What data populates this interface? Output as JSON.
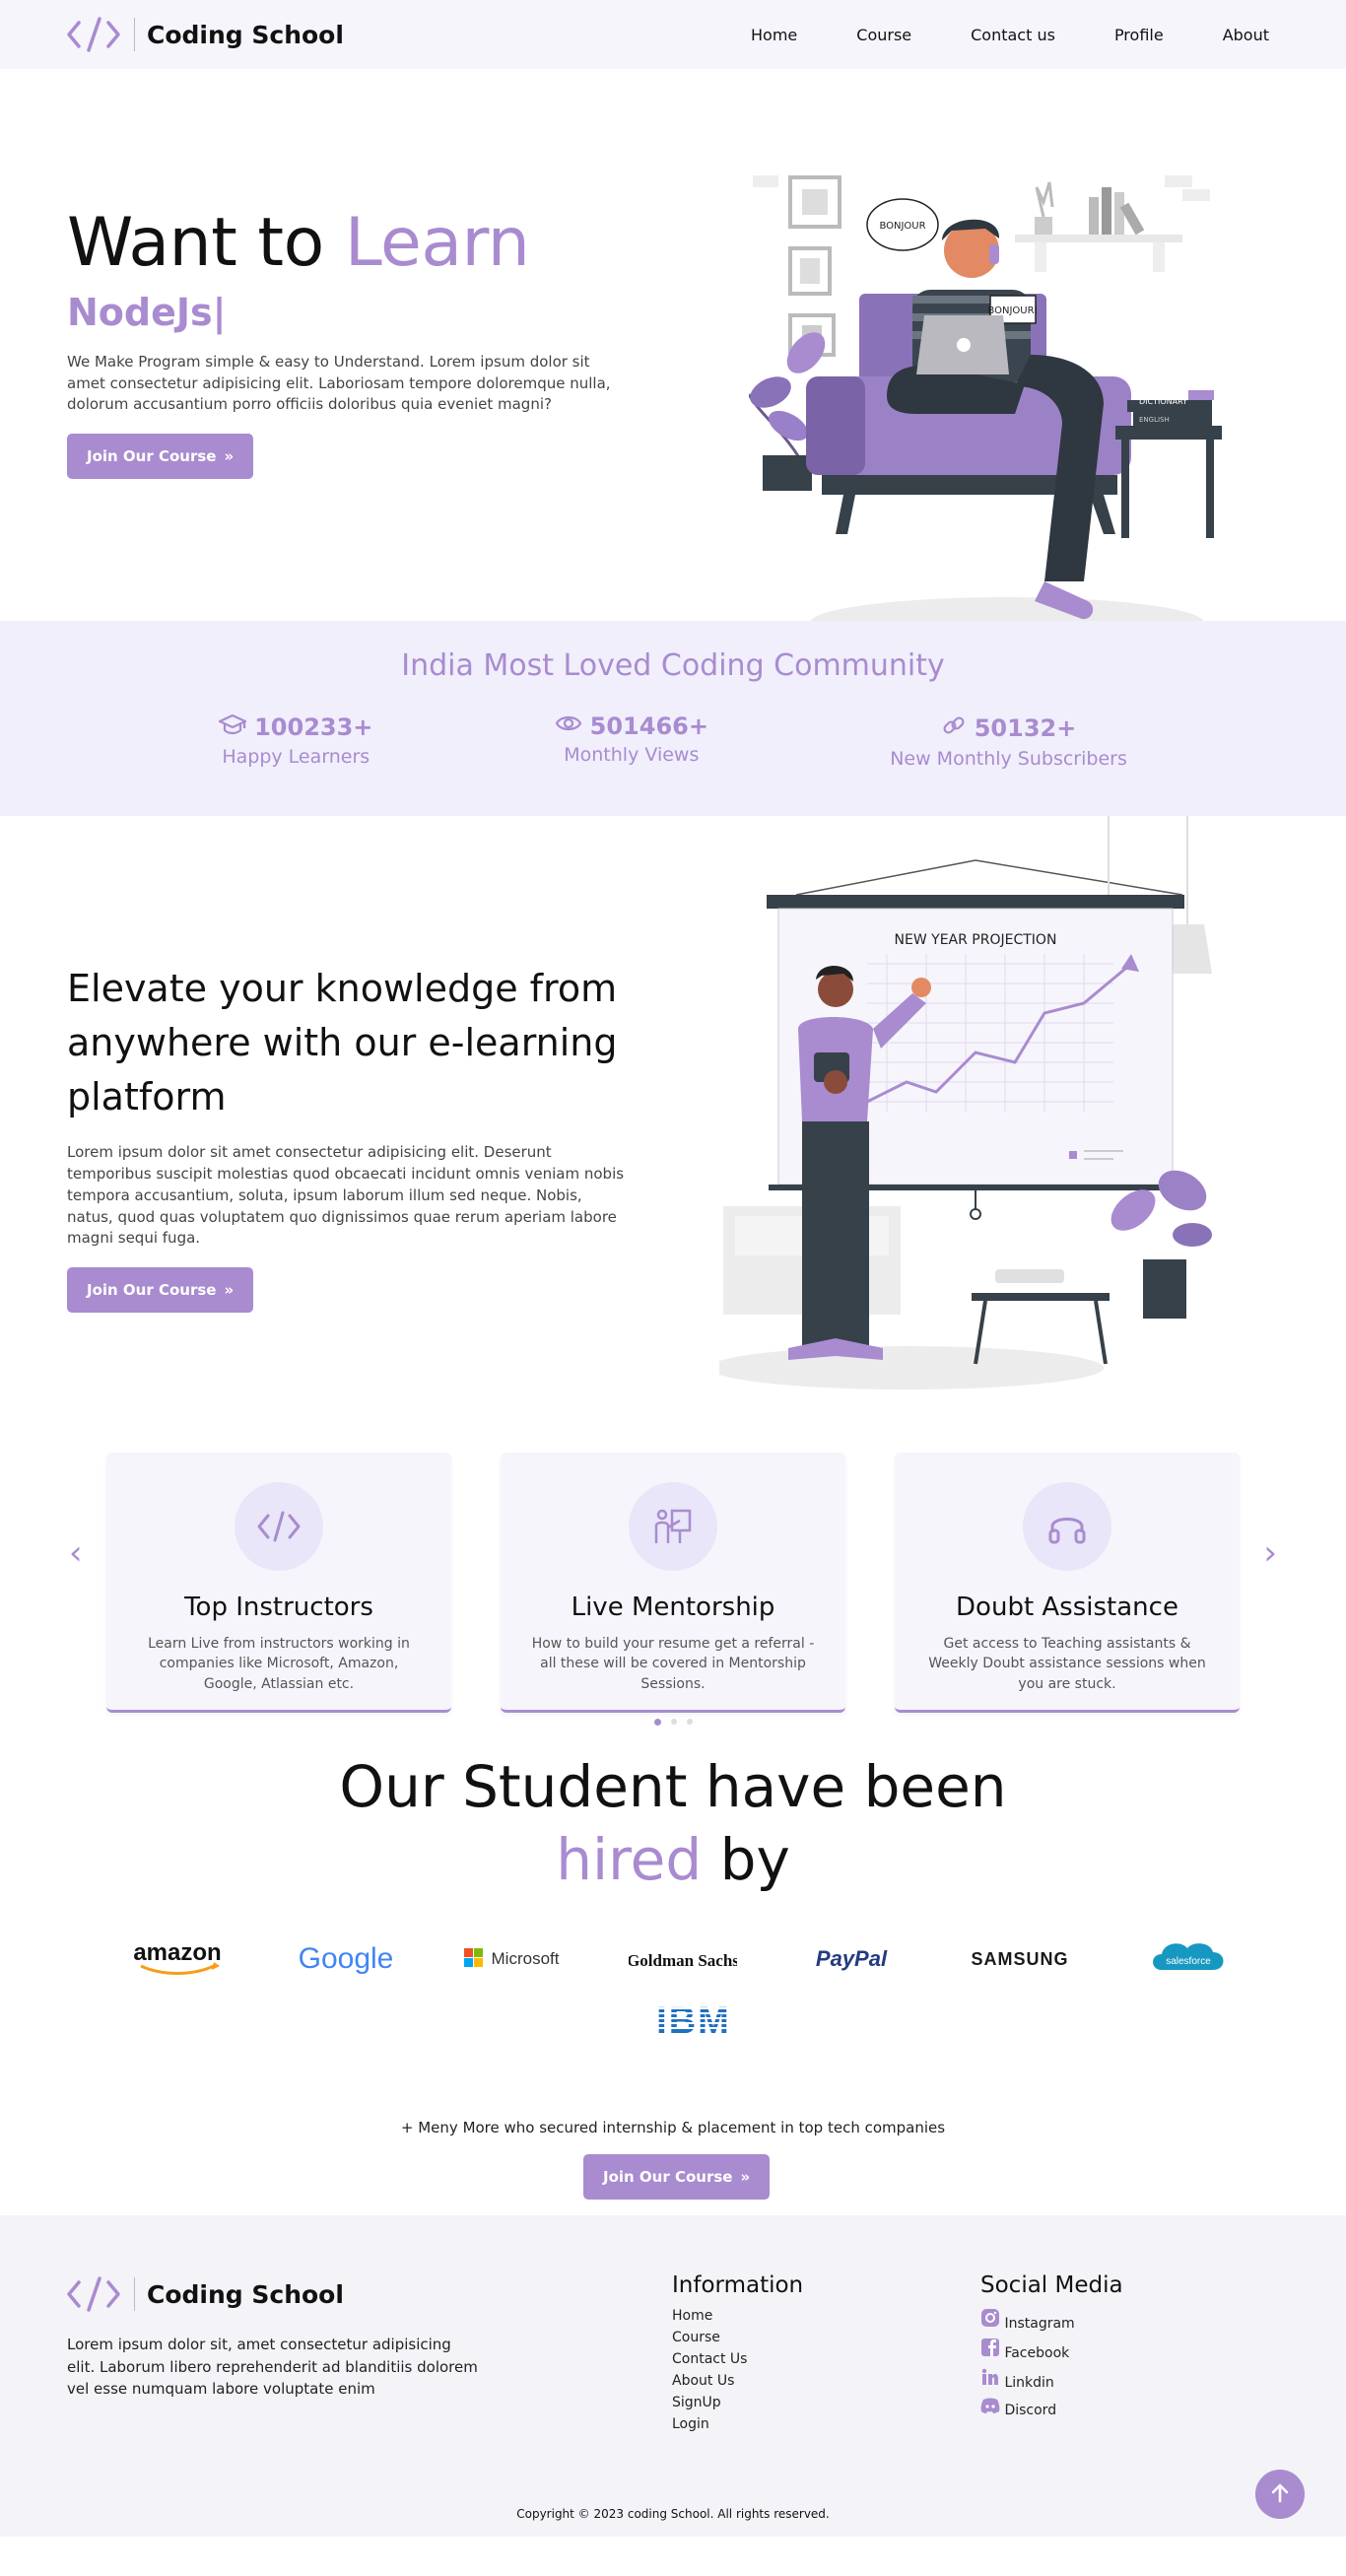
{
  "nav": {
    "brand": "Coding School",
    "links": [
      "Home",
      "Course",
      "Contact us",
      "Profile",
      "About"
    ]
  },
  "hero": {
    "title_prefix": "Want to ",
    "title_accent": "Learn",
    "typed": "NodeJs|",
    "description": "We Make Program simple & easy to Understand. Lorem ipsum dolor sit amet consectetur adipisicing elit. Laboriosam tempore doloremque nulla, dolorum accusantium porro officiis doloribus quia eveniet magni?",
    "button": "Join Our Course",
    "speech_1": "BONJOUR",
    "speech_2": "BONJOUR!",
    "book_1": "DICTIONARY",
    "book_2": "ENGLISH"
  },
  "stats": {
    "title": "India Most Loved Coding Community",
    "items": [
      {
        "value": "100233+",
        "label": "Happy Learners",
        "icon": "graduation-cap-icon"
      },
      {
        "value": "501466+",
        "label": "Monthly Views",
        "icon": "eye-icon"
      },
      {
        "value": "50132+",
        "label": "New Monthly Subscribers",
        "icon": "link-icon"
      }
    ]
  },
  "elevate": {
    "title": "Elevate your knowledge from anywhere with our e-learning platform",
    "description": "Lorem ipsum dolor sit amet consectetur adipisicing elit. Deserunt temporibus suscipit molestias quod obcaecati incidunt omnis veniam nobis tempora accusantium, soluta, ipsum laborum illum sed neque. Nobis, natus, quod quas voluptatem quo dignissimos quae rerum aperiam labore magni sequi fuga.",
    "button": "Join Our Course",
    "board_title": "NEW YEAR PROJECTION"
  },
  "features": {
    "prev": "‹",
    "next": "›",
    "cards": [
      {
        "title": "Top Instructors",
        "desc": "Learn Live from instructors working in companies like Microsoft, Amazon, Google, Atlassian etc.",
        "icon": "code-icon"
      },
      {
        "title": "Live Mentorship",
        "desc": "How to build your resume get a referral - all these will be covered in Mentorship Sessions.",
        "icon": "teacher-board-icon"
      },
      {
        "title": "Doubt Assistance",
        "desc": "Get access to Teaching assistants & Weekly Doubt assistance sessions when you are stuck.",
        "icon": "headphones-icon"
      }
    ]
  },
  "hired": {
    "line1": "Our Student have been",
    "accent": "hired",
    "line2_rest": " by",
    "logos": [
      "amazon",
      "Google",
      "Microsoft",
      "Goldman Sachs",
      "PayPal",
      "SAMSUNG",
      "salesforce",
      "IBM"
    ],
    "note": "+ Meny More who secured internship & placement in top tech companies",
    "button": "Join Our Course"
  },
  "footer": {
    "brand": "Coding School",
    "description": "Lorem ipsum dolor sit, amet consectetur adipisicing elit. Laborum libero reprehenderit ad blanditiis dolorem vel esse numquam labore voluptate enim",
    "info_title": "Information",
    "info_links": [
      "Home",
      "Course",
      "Contact Us",
      "About Us",
      "SignUp",
      "Login"
    ],
    "social_title": "Social Media",
    "social": [
      {
        "label": "Instagram",
        "icon": "instagram-icon"
      },
      {
        "label": "Facebook",
        "icon": "facebook-icon"
      },
      {
        "label": "Linkdin",
        "icon": "linkedin-icon"
      },
      {
        "label": "Discord",
        "icon": "discord-icon"
      }
    ],
    "copyright": "Copyright © 2023 coding School. All rights reserved."
  },
  "colors": {
    "accent": "#a98bd0",
    "stats_bg": "#f0effb",
    "card_bg": "#f6f5fb",
    "footer_bg": "#f3f3f8"
  }
}
